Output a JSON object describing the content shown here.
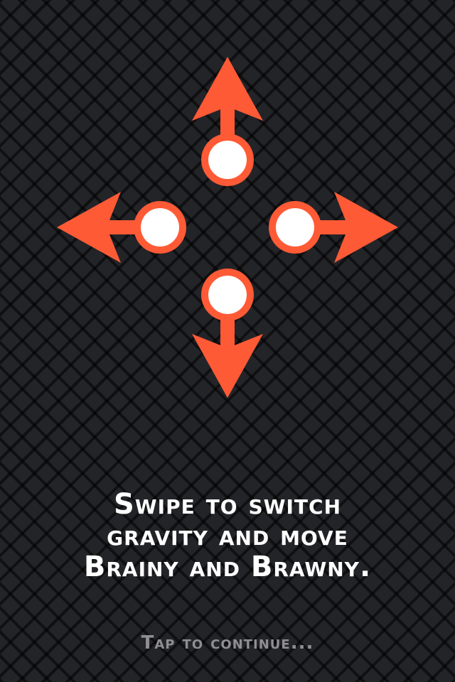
{
  "tutorial": {
    "instruction_lines": [
      "Swipe to switch",
      "gravity and move",
      "Brainy and Brawny."
    ],
    "tap_prompt": "Tap to continue..."
  },
  "diagram": {
    "directions": [
      "up",
      "left",
      "right",
      "down"
    ],
    "icons": [
      "swipe-up-arrow-icon",
      "swipe-left-arrow-icon",
      "swipe-right-arrow-icon",
      "swipe-down-arrow-icon"
    ]
  },
  "colors": {
    "background": "#232428",
    "accent": "#ff5a36",
    "knob": "#ffffff",
    "text_primary": "#ffffff",
    "text_secondary": "#8f8f93"
  }
}
